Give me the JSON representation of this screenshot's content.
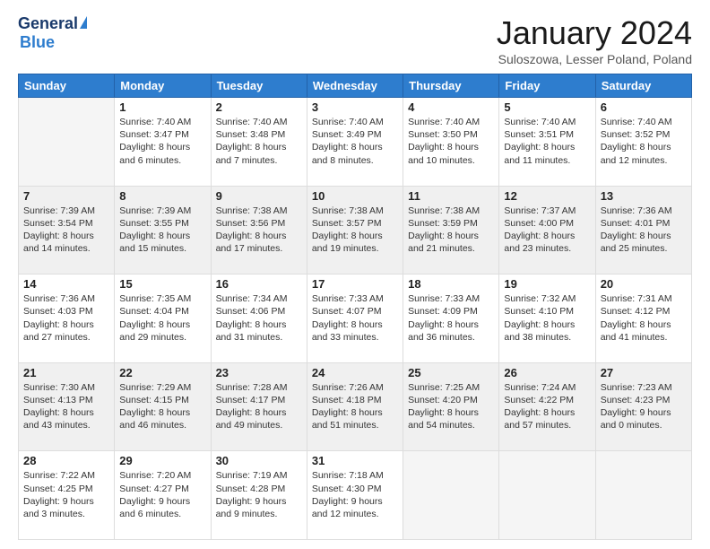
{
  "header": {
    "logo_general": "General",
    "logo_blue": "Blue",
    "month_title": "January 2024",
    "location": "Suloszowa, Lesser Poland, Poland"
  },
  "calendar": {
    "days_of_week": [
      "Sunday",
      "Monday",
      "Tuesday",
      "Wednesday",
      "Thursday",
      "Friday",
      "Saturday"
    ],
    "weeks": [
      {
        "shade": false,
        "days": [
          {
            "num": "",
            "content": ""
          },
          {
            "num": "1",
            "content": "Sunrise: 7:40 AM\nSunset: 3:47 PM\nDaylight: 8 hours\nand 6 minutes."
          },
          {
            "num": "2",
            "content": "Sunrise: 7:40 AM\nSunset: 3:48 PM\nDaylight: 8 hours\nand 7 minutes."
          },
          {
            "num": "3",
            "content": "Sunrise: 7:40 AM\nSunset: 3:49 PM\nDaylight: 8 hours\nand 8 minutes."
          },
          {
            "num": "4",
            "content": "Sunrise: 7:40 AM\nSunset: 3:50 PM\nDaylight: 8 hours\nand 10 minutes."
          },
          {
            "num": "5",
            "content": "Sunrise: 7:40 AM\nSunset: 3:51 PM\nDaylight: 8 hours\nand 11 minutes."
          },
          {
            "num": "6",
            "content": "Sunrise: 7:40 AM\nSunset: 3:52 PM\nDaylight: 8 hours\nand 12 minutes."
          }
        ]
      },
      {
        "shade": true,
        "days": [
          {
            "num": "7",
            "content": "Sunrise: 7:39 AM\nSunset: 3:54 PM\nDaylight: 8 hours\nand 14 minutes."
          },
          {
            "num": "8",
            "content": "Sunrise: 7:39 AM\nSunset: 3:55 PM\nDaylight: 8 hours\nand 15 minutes."
          },
          {
            "num": "9",
            "content": "Sunrise: 7:38 AM\nSunset: 3:56 PM\nDaylight: 8 hours\nand 17 minutes."
          },
          {
            "num": "10",
            "content": "Sunrise: 7:38 AM\nSunset: 3:57 PM\nDaylight: 8 hours\nand 19 minutes."
          },
          {
            "num": "11",
            "content": "Sunrise: 7:38 AM\nSunset: 3:59 PM\nDaylight: 8 hours\nand 21 minutes."
          },
          {
            "num": "12",
            "content": "Sunrise: 7:37 AM\nSunset: 4:00 PM\nDaylight: 8 hours\nand 23 minutes."
          },
          {
            "num": "13",
            "content": "Sunrise: 7:36 AM\nSunset: 4:01 PM\nDaylight: 8 hours\nand 25 minutes."
          }
        ]
      },
      {
        "shade": false,
        "days": [
          {
            "num": "14",
            "content": "Sunrise: 7:36 AM\nSunset: 4:03 PM\nDaylight: 8 hours\nand 27 minutes."
          },
          {
            "num": "15",
            "content": "Sunrise: 7:35 AM\nSunset: 4:04 PM\nDaylight: 8 hours\nand 29 minutes."
          },
          {
            "num": "16",
            "content": "Sunrise: 7:34 AM\nSunset: 4:06 PM\nDaylight: 8 hours\nand 31 minutes."
          },
          {
            "num": "17",
            "content": "Sunrise: 7:33 AM\nSunset: 4:07 PM\nDaylight: 8 hours\nand 33 minutes."
          },
          {
            "num": "18",
            "content": "Sunrise: 7:33 AM\nSunset: 4:09 PM\nDaylight: 8 hours\nand 36 minutes."
          },
          {
            "num": "19",
            "content": "Sunrise: 7:32 AM\nSunset: 4:10 PM\nDaylight: 8 hours\nand 38 minutes."
          },
          {
            "num": "20",
            "content": "Sunrise: 7:31 AM\nSunset: 4:12 PM\nDaylight: 8 hours\nand 41 minutes."
          }
        ]
      },
      {
        "shade": true,
        "days": [
          {
            "num": "21",
            "content": "Sunrise: 7:30 AM\nSunset: 4:13 PM\nDaylight: 8 hours\nand 43 minutes."
          },
          {
            "num": "22",
            "content": "Sunrise: 7:29 AM\nSunset: 4:15 PM\nDaylight: 8 hours\nand 46 minutes."
          },
          {
            "num": "23",
            "content": "Sunrise: 7:28 AM\nSunset: 4:17 PM\nDaylight: 8 hours\nand 49 minutes."
          },
          {
            "num": "24",
            "content": "Sunrise: 7:26 AM\nSunset: 4:18 PM\nDaylight: 8 hours\nand 51 minutes."
          },
          {
            "num": "25",
            "content": "Sunrise: 7:25 AM\nSunset: 4:20 PM\nDaylight: 8 hours\nand 54 minutes."
          },
          {
            "num": "26",
            "content": "Sunrise: 7:24 AM\nSunset: 4:22 PM\nDaylight: 8 hours\nand 57 minutes."
          },
          {
            "num": "27",
            "content": "Sunrise: 7:23 AM\nSunset: 4:23 PM\nDaylight: 9 hours\nand 0 minutes."
          }
        ]
      },
      {
        "shade": false,
        "days": [
          {
            "num": "28",
            "content": "Sunrise: 7:22 AM\nSunset: 4:25 PM\nDaylight: 9 hours\nand 3 minutes."
          },
          {
            "num": "29",
            "content": "Sunrise: 7:20 AM\nSunset: 4:27 PM\nDaylight: 9 hours\nand 6 minutes."
          },
          {
            "num": "30",
            "content": "Sunrise: 7:19 AM\nSunset: 4:28 PM\nDaylight: 9 hours\nand 9 minutes."
          },
          {
            "num": "31",
            "content": "Sunrise: 7:18 AM\nSunset: 4:30 PM\nDaylight: 9 hours\nand 12 minutes."
          },
          {
            "num": "",
            "content": ""
          },
          {
            "num": "",
            "content": ""
          },
          {
            "num": "",
            "content": ""
          }
        ]
      }
    ]
  }
}
